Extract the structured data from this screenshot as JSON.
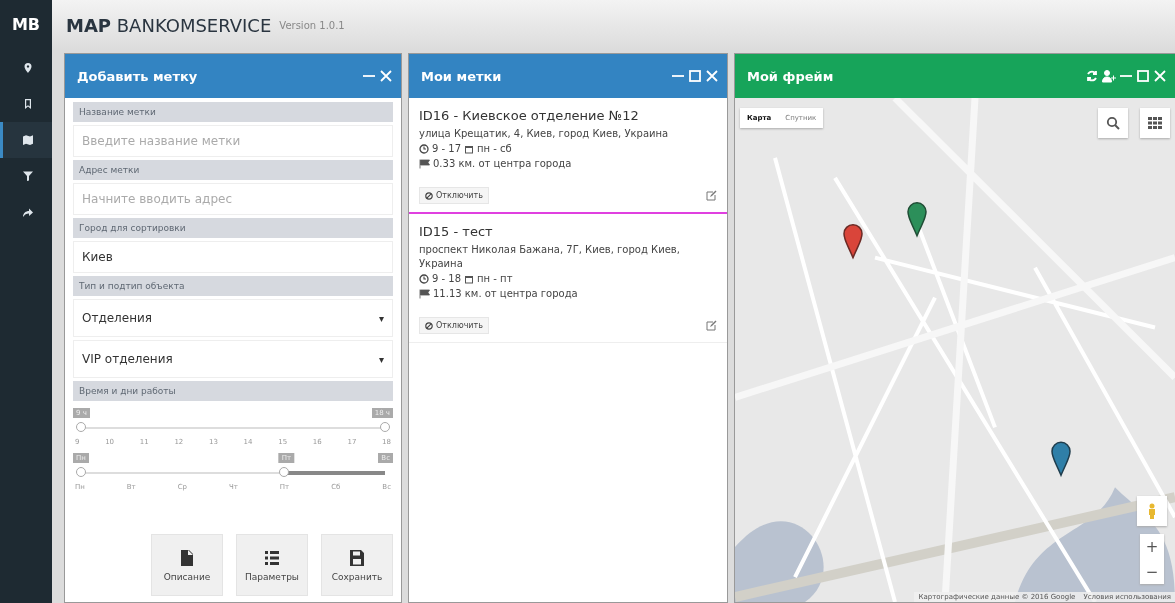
{
  "app": {
    "logo": "MB",
    "title_bold": "MAP",
    "title": "BANKOMSERVICE",
    "version": "Version 1.0.1"
  },
  "sidebar": {
    "items": [
      {
        "kind": "pin",
        "selected": false
      },
      {
        "kind": "bookmark",
        "selected": false
      },
      {
        "kind": "map",
        "selected": true
      },
      {
        "kind": "filter",
        "selected": false
      },
      {
        "kind": "share",
        "selected": false
      }
    ]
  },
  "add_panel": {
    "title": "Добавить метку",
    "controls": [
      {
        "kind": "minimize"
      },
      {
        "kind": "close"
      }
    ],
    "fields": [
      {
        "kind": "input",
        "label": "Название метки",
        "placeholder": "Введите название метки"
      },
      {
        "kind": "input",
        "label": "Адрес метки",
        "placeholder": "Начните вводить адрес"
      },
      {
        "kind": "input",
        "label": "Город для сортировки",
        "value": "Киев"
      },
      {
        "kind": "select",
        "label": "Тип и подтип объекта",
        "value": "Отделения",
        "caret": "▾"
      },
      {
        "kind": "select",
        "value": "VIP отделения",
        "caret": "▾"
      }
    ],
    "hours_label": "Время и дни работы",
    "sliders": [
      {
        "min_label": "9 ч",
        "max_label": "18 ч",
        "handles": [
          {
            "level": 0
          },
          {
            "level": 1
          }
        ],
        "ticks": [
          "9",
          "10",
          "11",
          "12",
          "13",
          "14",
          "15",
          "16",
          "17",
          "18"
        ]
      },
      {
        "min_label": "Пн",
        "mid_label": "Пт",
        "max_label": "Вс",
        "handles": [
          {
            "level": 0
          },
          {
            "level": 0.667
          }
        ],
        "ticks": [
          "Пн",
          "Вт",
          "Ср",
          "Чт",
          "Пт",
          "Сб",
          "Вс"
        ]
      }
    ],
    "buttons": [
      {
        "kind": "file",
        "label": "Описание"
      },
      {
        "kind": "list",
        "label": "Параметры"
      },
      {
        "kind": "save",
        "label": "Сохранить"
      }
    ]
  },
  "marks_panel": {
    "title": "Мои метки",
    "controls": [
      {
        "kind": "minimize"
      },
      {
        "kind": "maximize"
      },
      {
        "kind": "close"
      }
    ],
    "marks": [
      {
        "title": "ID16 - Киевское отделение №12",
        "address": "улица Крещатик, 4, Киев, город Киев, Украина",
        "hours": "9 - 17",
        "days": "пн - сб",
        "distance": "0.33 км. от центра города",
        "button": "Отключить",
        "selected": true
      },
      {
        "title": "ID15 - тест",
        "address": "проспект Николая Бажана, 7Г, Киев, город Киев, Украина",
        "hours": "9 - 18",
        "days": "пн - пт",
        "distance": "11.13 км. от центра города",
        "button": "Отключить",
        "selected": false
      }
    ]
  },
  "frame_panel": {
    "title": "Мой фрейм",
    "controls": [
      {
        "kind": "refresh"
      },
      {
        "kind": "user"
      },
      {
        "kind": "minimize"
      },
      {
        "kind": "maximize"
      },
      {
        "kind": "close"
      }
    ],
    "map": {
      "kind": "picture",
      "types": [
        {
          "label": "Карта",
          "selected": true
        },
        {
          "label": "Спутник",
          "selected": false
        }
      ],
      "zoom_in": "+",
      "zoom_out": "−",
      "attribution": "Картографические данные © 2016 Google",
      "terms": "Условия использования"
    }
  }
}
